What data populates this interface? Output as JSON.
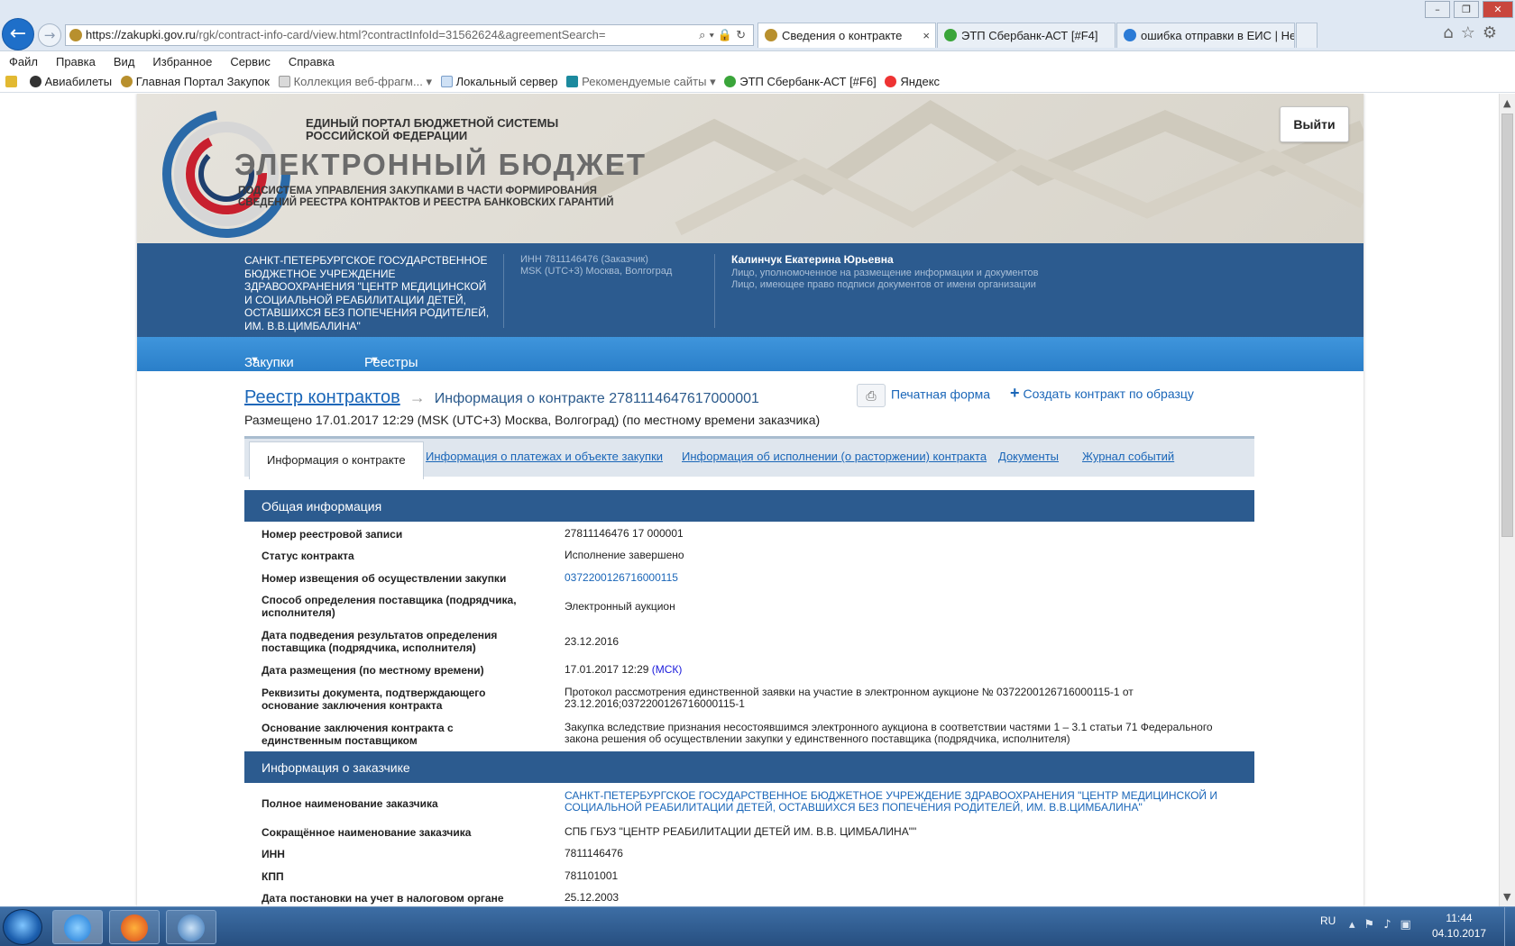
{
  "browser": {
    "url_host": "https://zakupki.gov.ru",
    "url_path": "/rgk/contract-info-card/view.html?contractInfoId=31562624&agreementSearch=",
    "tabs": [
      {
        "label": "Сведения о контракте",
        "close": "×"
      },
      {
        "label": "ЭТП Сбербанк-АСТ [#F4]"
      },
      {
        "label": "ошибка отправки в ЕИС | Hel..."
      }
    ],
    "menu": [
      "Файл",
      "Правка",
      "Вид",
      "Избранное",
      "Сервис",
      "Справка"
    ],
    "favorites": [
      "Авиабилеты",
      "Главная Портал Закупок",
      "Коллекция веб-фрагм...",
      "Локальный сервер",
      "Рекомендуемые сайты",
      "ЭТП Сбербанк-АСТ [#F6]",
      "Яндекс"
    ]
  },
  "banner": {
    "line1": "ЕДИНЫЙ ПОРТАЛ БЮДЖЕТНОЙ СИСТЕМЫ РОССИЙСКОЙ ФЕДЕРАЦИИ",
    "title": "ЭЛЕКТРОННЫЙ БЮДЖЕТ",
    "subtitle": "ПОДСИСТЕМА УПРАВЛЕНИЯ ЗАКУПКАМИ В ЧАСТИ ФОРМИРОВАНИЯ СВЕДЕНИЙ РЕЕСТРА КОНТРАКТОВ И РЕЕСТРА БАНКОВСКИХ ГАРАНТИЙ",
    "logout": "Выйти"
  },
  "org": {
    "name": "САНКТ-ПЕТЕРБУРГСКОЕ ГОСУДАРСТВЕННОЕ БЮДЖЕТНОЕ УЧРЕЖДЕНИЕ ЗДРАВООХРАНЕНИЯ \"ЦЕНТР МЕДИЦИНСКОЙ И СОЦИАЛЬНОЙ РЕАБИЛИТАЦИИ ДЕТЕЙ, ОСТАВШИХСЯ БЕЗ ПОПЕЧЕНИЯ РОДИТЕЛЕЙ, ИМ. В.В.ЦИМБАЛИНА\"",
    "inn": "ИНН 7811146476 (Заказчик)",
    "tz": "MSK (UTC+3) Москва, Волгоград",
    "user": "Калинчук Екатерина Юрьевна",
    "role1": "Лицо, уполномоченное на размещение информации и документов",
    "role2": "Лицо, имеющее право подписи документов от имени организации"
  },
  "nav": {
    "purchases": "Закупки",
    "registries": "Реестры"
  },
  "page": {
    "crumb_root": "Реестр контрактов",
    "crumb_current": "Информация о контракте 2781114647617000001",
    "print": "Печатная форма",
    "create": "Создать контракт по образцу",
    "placed": "Размещено 17.01.2017 12:29 (MSK (UTC+3) Москва, Волгоград) (по местному времени заказчика)"
  },
  "tabs": [
    "Информация о контракте",
    "Информация о платежах и объекте закупки",
    "Информация об исполнении (о расторжении) контракта",
    "Документы",
    "Журнал событий"
  ],
  "general": {
    "title": "Общая информация",
    "rows": [
      {
        "k": "Номер реестровой записи",
        "v": "27811146476 17 000001"
      },
      {
        "k": "Статус контракта",
        "v": "Исполнение завершено"
      },
      {
        "k": "Номер извещения об осуществлении закупки",
        "v": "0372200126716000115"
      },
      {
        "k": "Способ определения поставщика (подрядчика, исполнителя)",
        "v": "Электронный аукцион"
      },
      {
        "k": "Дата подведения результатов определения поставщика (подрядчика, исполнителя)",
        "v": "23.12.2016"
      },
      {
        "k": "Дата размещения (по местному времени)",
        "v": "17.01.2017 12:29",
        "tz": "(МСК)"
      },
      {
        "k": "Реквизиты документа, подтверждающего основание заключения контракта",
        "v": "Протокол рассмотрения единственной заявки на участие в электронном аукционе № 0372200126716000115-1 от 23.12.2016;0372200126716000115-1"
      },
      {
        "k": "Основание заключения контракта с единственным поставщиком",
        "v": "Закупка вследствие признания несостоявшимся электронного аукциона в соответствии частями 1 – 3.1 статьи 71 Федерального закона решения об осуществлении закупки у единственного поставщика (подрядчика, исполнителя)"
      }
    ]
  },
  "customer": {
    "title": "Информация о заказчике",
    "rows": [
      {
        "k": "Полное наименование заказчика",
        "v": "САНКТ-ПЕТЕРБУРГСКОЕ ГОСУДАРСТВЕННОЕ БЮДЖЕТНОЕ УЧРЕЖДЕНИЕ ЗДРАВООХРАНЕНИЯ \"ЦЕНТР МЕДИЦИНСКОЙ И СОЦИАЛЬНОЙ РЕАБИЛИТАЦИИ ДЕТЕЙ, ОСТАВШИХСЯ БЕЗ ПОПЕЧЕНИЯ РОДИТЕЛЕЙ, ИМ. В.В.ЦИМБАЛИНА\""
      },
      {
        "k": "Сокращённое наименование заказчика",
        "v": "СПБ ГБУЗ \"ЦЕНТР РЕАБИЛИТАЦИИ ДЕТЕЙ ИМ. В.В. ЦИМБАЛИНА\"\""
      },
      {
        "k": "ИНН",
        "v": "7811146476"
      },
      {
        "k": "КПП",
        "v": "781101001"
      },
      {
        "k": "Дата постановки на учет в налоговом органе",
        "v": "25.12.2003"
      }
    ]
  },
  "taskbar": {
    "lang": "RU",
    "time": "11:44",
    "date": "04.10.2017"
  },
  "colors": {
    "primary": "#2c5b8f",
    "nav": "#2a7fc9",
    "link": "#1a66b8"
  }
}
